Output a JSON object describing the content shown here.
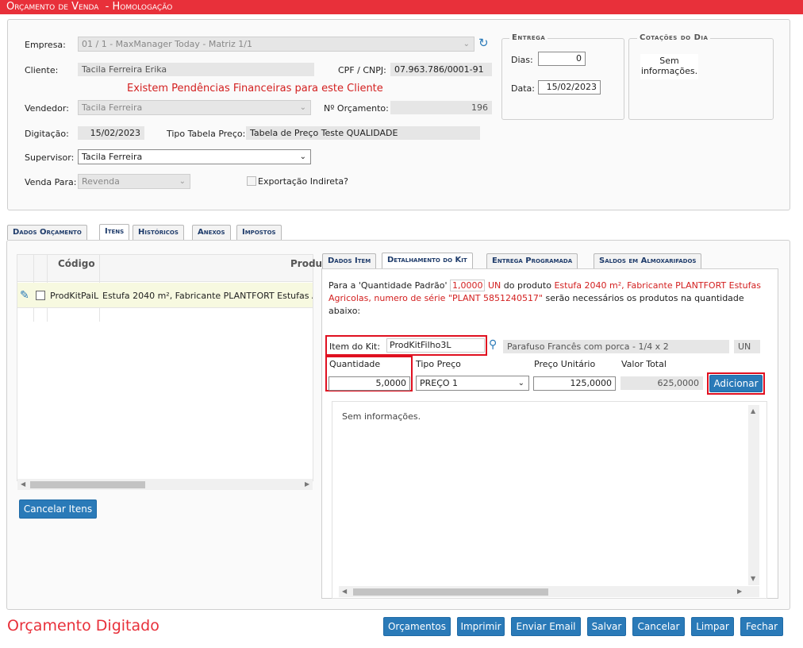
{
  "window": {
    "title": "Orçamento de Venda  - Homologação"
  },
  "header_form": {
    "empresa_label": "Empresa:",
    "empresa_value": "01 / 1 - MaxManager Today - Matriz 1/1",
    "cliente_label": "Cliente:",
    "cliente_value": "Tacila Ferreira Erika",
    "cpf_label": "CPF / CNPJ:",
    "cpf_value": "07.963.786/0001-91",
    "pendencias_msg": "Existem Pendências Financeiras para este Cliente",
    "vendedor_label": "Vendedor:",
    "vendedor_value": "Tacila Ferreira",
    "orcamento_label": "Nº Orçamento:",
    "orcamento_value": "196",
    "digitacao_label": "Digitação:",
    "digitacao_value": "15/02/2023",
    "tabela_label": "Tipo Tabela Preço:",
    "tabela_value": "Tabela de Preço Teste QUALIDADE",
    "supervisor_label": "Supervisor:",
    "supervisor_value": "Tacila Ferreira",
    "venda_label": "Venda Para:",
    "venda_value": "Revenda",
    "exportacao_label": "Exportação Indireta?"
  },
  "entrega": {
    "legend": "Entrega",
    "dias_label": "Dias:",
    "dias_value": "0",
    "data_label": "Data:",
    "data_value": "15/02/2023"
  },
  "cotacoes": {
    "legend": "Cotações do Dia",
    "empty": "Sem informações."
  },
  "main_tabs": [
    "Dados Orçamento",
    "Itens",
    "Históricos",
    "Anexos",
    "Impostos"
  ],
  "items_grid": {
    "col_codigo": "Código",
    "col_produto": "Produ",
    "row_codigo": "ProdKitPaiL",
    "row_produto": "Estufa 2040 m², Fabricante PLANTFORT Estufas A"
  },
  "cancelar_itens": "Cancelar Itens",
  "sub_tabs": [
    "Dados Item",
    "Detalhamento do Kit",
    "Entrega Programada",
    "Saldos em Almoxarifados"
  ],
  "kit": {
    "intro_prefix": "Para a 'Quantidade Padrão'",
    "qtd_padrao": "1,0000",
    "un": "UN",
    "intro_mid": "do produto",
    "produto": "Estufa 2040 m², Fabricante PLANTFORT Estufas",
    "produto_line2": "Agricolas, numero de série \"PLANT 5851240517\"",
    "intro_suffix": "serão necessários os produtos na quantidade",
    "intro_suffix2": "abaixo:",
    "item_label": "Item do Kit:",
    "item_value": "ProdKitFilho3L",
    "item_desc": "Parafuso Francês com porca - 1/4 x 2",
    "item_un": "UN",
    "qtd_label": "Quantidade",
    "qtd_value": "5,0000",
    "tipo_label": "Tipo Preço",
    "tipo_value": "PREÇO 1",
    "unit_label": "Preço Unitário",
    "unit_value": "125,0000",
    "total_label": "Valor Total",
    "total_value": "625,0000",
    "adicionar": "Adicionar",
    "list_empty": "Sem informações."
  },
  "status_text": "Orçamento Digitado",
  "footer_buttons": [
    "Orçamentos",
    "Imprimir",
    "Enviar Email",
    "Salvar",
    "Cancelar",
    "Limpar",
    "Fechar"
  ],
  "colors": {
    "accent_red": "#e8303a",
    "button_blue": "#2a7ab8",
    "tab_text": "#1f3c6b",
    "alert_red": "#d32020"
  }
}
